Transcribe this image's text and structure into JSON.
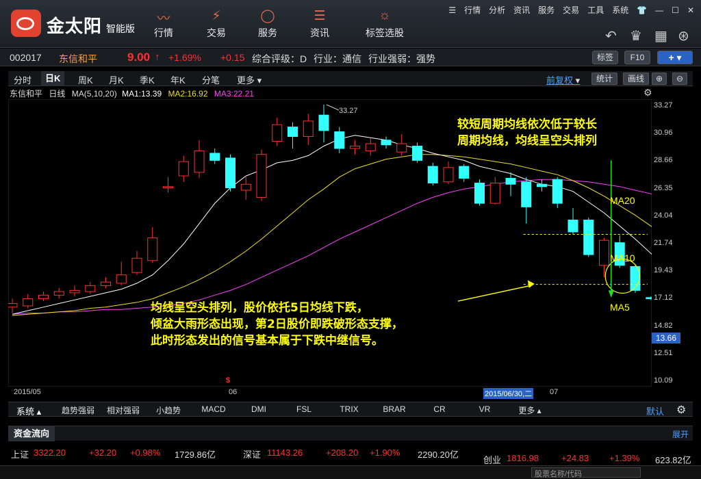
{
  "app": {
    "brand": "金太阳",
    "brand_sub": "智能版"
  },
  "nav": [
    {
      "label": "行情",
      "icon": "trend-icon"
    },
    {
      "label": "交易",
      "icon": "trade-icon"
    },
    {
      "label": "服务",
      "icon": "user-icon"
    },
    {
      "label": "资讯",
      "icon": "news-icon"
    },
    {
      "label": "标签选股",
      "icon": "bulb-icon"
    }
  ],
  "toplinks": [
    "行情",
    "分析",
    "资讯",
    "服务",
    "交易",
    "工具",
    "系统"
  ],
  "stock": {
    "code": "002017",
    "name": "东信和平",
    "price": "9.00",
    "arrow": "↑",
    "pct": "+1.69%",
    "change": "+0.15",
    "rating": "综合评级：D",
    "industry": "行业：通信",
    "strength": "行业强弱：强势",
    "btn_tag": "标签",
    "btn_f10": "F10"
  },
  "periods": [
    "分时",
    "日K",
    "周K",
    "月K",
    "季K",
    "年K",
    "分笔",
    "更多"
  ],
  "tools": {
    "adjust": "前复权",
    "stats": "统计",
    "draw": "画线"
  },
  "ma_row": {
    "name": "东信和平",
    "type": "日线",
    "ma": "MA(5,10,20)",
    "ma1": "MA1:13.39",
    "ma2": "MA2:16.92",
    "ma3": "MA3:22.21"
  },
  "y_ticks": [
    "33.27",
    "30.96",
    "28.66",
    "26.35",
    "24.04",
    "21.74",
    "19.43",
    "17.12",
    "14.82",
    "12.51",
    "10.09"
  ],
  "current_label": "13.66",
  "high_label": "33.27",
  "low_label": "11.19",
  "x_labels": {
    "start": "2015/05",
    "mid": "06",
    "selected": "2015/06/30,二",
    "end": "07"
  },
  "annotations": {
    "top_line1": "较短周期均线依次低于较长",
    "top_line2": "周期均线，均线呈空头排列",
    "bottom_line1": "均线呈空头排列，股价依托5日均线下跌，",
    "bottom_line2": "倾盆大雨形态出现，第2日股价即跌破形态支撑，",
    "bottom_line3": "此时形态发出的信号基本属于下跌中继信号。",
    "ma20": "MA20",
    "ma10": "MA10",
    "ma5": "MA5"
  },
  "indicators": {
    "system": "系统",
    "items": [
      "趋势强弱",
      "相对强弱",
      "小趋势",
      "MACD",
      "DMI",
      "FSL",
      "TRIX",
      "BRAR",
      "CR",
      "VR",
      "更多"
    ],
    "default": "默认"
  },
  "flow": {
    "title": "资金流向",
    "expand": "展开"
  },
  "indexes": [
    {
      "name": "上证",
      "value": "3322.20",
      "change": "+32.20",
      "pct": "+0.98%",
      "amount": "1729.86亿"
    },
    {
      "name": "深证",
      "value": "11143.26",
      "change": "+208.20",
      "pct": "+1.90%",
      "amount": "2290.20亿"
    },
    {
      "name": "创业",
      "value": "1816.98",
      "change": "+24.83",
      "pct": "+1.39%",
      "amount": "623.82亿"
    }
  ],
  "search_placeholder": "股票名称/代码",
  "colors": {
    "up": "#ff3030",
    "down": "#33ffff",
    "ma5": "#ffffff",
    "ma10": "#f0e020",
    "ma20": "#ff40ff",
    "annotation": "#ffff00"
  },
  "chart_data": {
    "type": "candlestick",
    "ylim": [
      10.09,
      33.27
    ],
    "candles": [
      {
        "o": 16.3,
        "c": 16.6,
        "h": 17.0,
        "l": 15.8
      },
      {
        "o": 16.4,
        "c": 17.0,
        "h": 17.4,
        "l": 16.2
      },
      {
        "o": 17.0,
        "c": 17.3,
        "h": 17.6,
        "l": 16.8
      },
      {
        "o": 17.3,
        "c": 17.6,
        "h": 17.9,
        "l": 17.0
      },
      {
        "o": 17.5,
        "c": 17.7,
        "h": 18.1,
        "l": 17.2
      },
      {
        "o": 17.6,
        "c": 18.1,
        "h": 18.4,
        "l": 17.4
      },
      {
        "o": 18.1,
        "c": 18.4,
        "h": 18.8,
        "l": 17.9
      },
      {
        "o": 18.3,
        "c": 19.0,
        "h": 20.1,
        "l": 18.1
      },
      {
        "o": 19.2,
        "c": 20.4,
        "h": 21.0,
        "l": 19.0
      },
      {
        "o": 20.2,
        "c": 22.1,
        "h": 23.0,
        "l": 20.0
      },
      {
        "o": 26.3,
        "c": 26.4,
        "h": 27.2,
        "l": 25.9
      },
      {
        "o": 27.3,
        "c": 28.5,
        "h": 29.0,
        "l": 26.8
      },
      {
        "o": 27.6,
        "c": 29.4,
        "h": 30.3,
        "l": 27.1
      },
      {
        "o": 29.2,
        "c": 28.6,
        "h": 29.6,
        "l": 28.3
      },
      {
        "o": 28.8,
        "c": 26.3,
        "h": 29.1,
        "l": 26.0
      },
      {
        "o": 26.1,
        "c": 26.6,
        "h": 27.3,
        "l": 25.3
      },
      {
        "o": 25.5,
        "c": 29.1,
        "h": 29.5,
        "l": 25.2
      },
      {
        "o": 30.2,
        "c": 31.6,
        "h": 32.2,
        "l": 29.8
      },
      {
        "o": 31.4,
        "c": 30.6,
        "h": 31.8,
        "l": 29.6
      },
      {
        "o": 30.6,
        "c": 31.9,
        "h": 32.5,
        "l": 29.9
      },
      {
        "o": 32.4,
        "c": 31.1,
        "h": 33.27,
        "l": 30.1
      },
      {
        "o": 31.0,
        "c": 29.6,
        "h": 31.4,
        "l": 29.2
      },
      {
        "o": 29.6,
        "c": 29.8,
        "h": 30.3,
        "l": 29.1
      },
      {
        "o": 29.4,
        "c": 30.0,
        "h": 30.5,
        "l": 29.0
      },
      {
        "o": 30.3,
        "c": 29.9,
        "h": 30.6,
        "l": 29.6
      },
      {
        "o": 29.3,
        "c": 30.0,
        "h": 30.8,
        "l": 29.0
      },
      {
        "o": 29.8,
        "c": 28.6,
        "h": 30.1,
        "l": 28.4
      },
      {
        "o": 28.1,
        "c": 26.7,
        "h": 28.4,
        "l": 26.5
      },
      {
        "o": 26.8,
        "c": 28.0,
        "h": 28.5,
        "l": 26.6
      },
      {
        "o": 28.1,
        "c": 27.1,
        "h": 28.3,
        "l": 26.8
      },
      {
        "o": 26.7,
        "c": 25.0,
        "h": 27.0,
        "l": 24.8
      },
      {
        "o": 25.0,
        "c": 26.7,
        "h": 27.2,
        "l": 24.9
      },
      {
        "o": 27.1,
        "c": 26.6,
        "h": 27.6,
        "l": 25.6
      },
      {
        "o": 26.8,
        "c": 24.7,
        "h": 27.2,
        "l": 23.3
      },
      {
        "o": 26.6,
        "c": 26.4,
        "h": 27.0,
        "l": 26.0
      },
      {
        "o": 27.0,
        "c": 25.0,
        "h": 27.2,
        "l": 24.6
      },
      {
        "o": 23.6,
        "c": 22.6,
        "h": 24.6,
        "l": 22.4
      },
      {
        "o": 23.6,
        "c": 20.7,
        "h": 23.8,
        "l": 20.5
      },
      {
        "o": 19.8,
        "c": 21.9,
        "h": 22.1,
        "l": 18.8
      },
      {
        "o": 21.7,
        "c": 19.8,
        "h": 22.3,
        "l": 19.6
      },
      {
        "o": 19.7,
        "c": 17.7,
        "h": 19.9,
        "l": 17.5
      },
      {
        "o": 17.1,
        "c": 17.0,
        "h": 17.2,
        "l": 16.9
      },
      {
        "o": 17.5,
        "c": 14.5,
        "h": 17.6,
        "l": 14.4
      },
      {
        "o": 13.1,
        "c": 12.8,
        "h": 13.2,
        "l": 12.7
      },
      {
        "o": 11.2,
        "c": 12.8,
        "h": 12.9,
        "l": 11.19
      }
    ],
    "ma5": [
      15.7,
      16.0,
      16.3,
      16.6,
      16.9,
      17.2,
      17.5,
      17.8,
      18.3,
      19.0,
      20.2,
      21.6,
      23.3,
      25.0,
      26.3,
      27.3,
      27.8,
      28.4,
      28.6,
      29.0,
      29.8,
      30.4,
      30.7,
      30.5,
      30.3,
      29.9,
      29.6,
      29.2,
      28.9,
      28.6,
      28.1,
      27.8,
      27.5,
      27.0,
      26.6,
      26.4,
      26.0,
      25.1,
      24.2,
      23.1,
      22.0,
      20.8,
      19.5,
      17.4,
      15.0
    ],
    "ma10": [
      15.6,
      15.7,
      15.8,
      15.9,
      16.0,
      16.2,
      16.3,
      16.5,
      16.7,
      17.0,
      17.5,
      18.0,
      18.6,
      19.3,
      20.1,
      21.0,
      22.0,
      23.1,
      24.2,
      25.3,
      26.2,
      27.2,
      27.9,
      28.3,
      28.7,
      28.9,
      29.1,
      29.1,
      29.0,
      28.9,
      28.7,
      28.5,
      28.3,
      28.0,
      27.7,
      27.4,
      26.9,
      26.3,
      25.6,
      24.8,
      24.0,
      23.1,
      22.0,
      21.2,
      20.7
    ],
    "ma20": [
      15.7,
      15.8,
      15.8,
      15.9,
      15.9,
      16.0,
      16.1,
      16.1,
      16.2,
      16.3,
      16.4,
      16.6,
      16.9,
      17.3,
      17.7,
      18.2,
      18.8,
      19.4,
      20.0,
      20.6,
      21.3,
      22.0,
      22.6,
      23.2,
      23.8,
      24.4,
      25.0,
      25.5,
      25.9,
      26.2,
      26.4,
      26.6,
      26.8,
      26.9,
      27.0,
      27.0,
      26.9,
      26.8,
      26.6,
      26.4,
      26.1,
      25.8,
      25.3,
      24.7,
      24.0
    ]
  }
}
